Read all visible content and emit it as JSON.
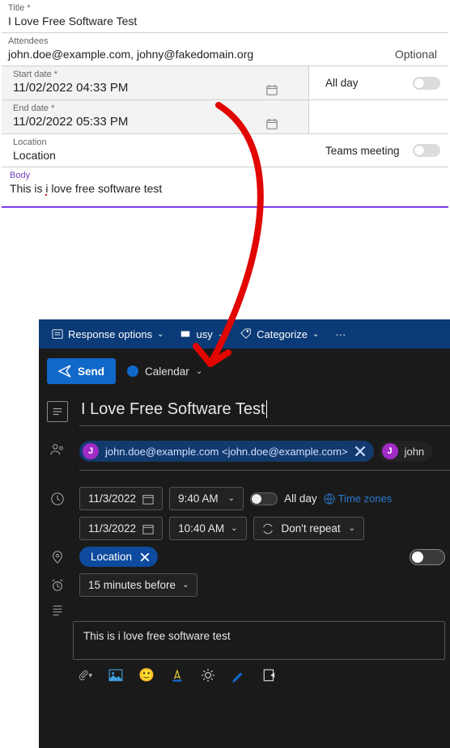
{
  "form": {
    "title_label": "Title *",
    "title": "I Love Free Software Test",
    "attendees_label": "Attendees",
    "attendees": "john.doe@example.com, johny@fakedomain.org",
    "optional": "Optional",
    "start_label": "Start date *",
    "start": "11/02/2022 04:33 PM",
    "end_label": "End date *",
    "end": "11/02/2022 05:33 PM",
    "allday": "All day",
    "location_label": "Location",
    "location": "Location",
    "teams": "Teams meeting",
    "body_label": "Body",
    "body_a": "This is ",
    "body_b": "i",
    "body_c": " love free software test"
  },
  "outlook": {
    "menu_response": "Response options",
    "menu_busy": "usy",
    "menu_categorize": "Categorize",
    "send": "Send",
    "calendar": "Calendar",
    "title": "I Love Free Software Test",
    "att1": "john.doe@example.com <john.doe@example.com>",
    "att2": "john",
    "initial": "J",
    "date1": "11/3/2022",
    "time1": "9:40 AM",
    "date2": "11/3/2022",
    "time2": "10:40 AM",
    "allday": "All day",
    "tz": "Time zones",
    "repeat": "Don't repeat",
    "location": "Location",
    "reminder": "15 minutes before",
    "body": "This is i love free software test"
  }
}
